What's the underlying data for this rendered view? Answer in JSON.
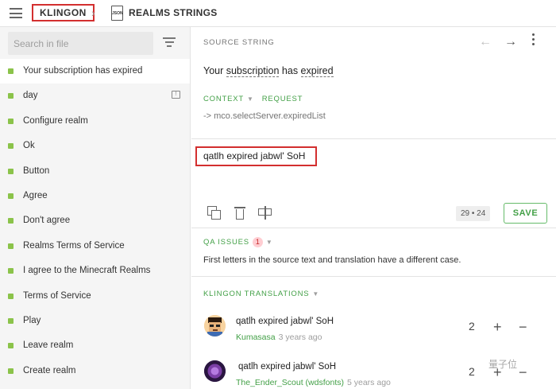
{
  "header": {
    "language": "KLINGON",
    "breadcrumb_separator": "›",
    "file_icon_label": "JSON",
    "file_name": "REALMS STRINGS"
  },
  "sidebar": {
    "search_placeholder": "Search in file",
    "items": [
      {
        "label": "Your subscription has expired",
        "active": true
      },
      {
        "label": "day",
        "has_comment": true
      },
      {
        "label": "Configure realm"
      },
      {
        "label": "Ok"
      },
      {
        "label": "Button"
      },
      {
        "label": "Agree"
      },
      {
        "label": "Don't agree"
      },
      {
        "label": "Realms Terms of Service"
      },
      {
        "label": "I agree to the Minecraft Realms"
      },
      {
        "label": "Terms of Service"
      },
      {
        "label": "Play"
      },
      {
        "label": "Leave realm"
      },
      {
        "label": "Create realm"
      }
    ],
    "status_color": "#8bc34a"
  },
  "source": {
    "header": "SOURCE STRING",
    "text_part1": "Your ",
    "term1": "subscription",
    "text_part2": " has ",
    "term2": "expired",
    "context_label": "CONTEXT",
    "request_label": "REQUEST",
    "context_value": "-> mco.selectServer.expiredList"
  },
  "editor": {
    "translation": "qatlh expired jabwl' SoH",
    "counter": "29 • 24",
    "save_label": "SAVE"
  },
  "qa": {
    "header": "QA ISSUES",
    "count": "1",
    "message": "First letters in the source text and translation have a different case."
  },
  "translations": {
    "header": "KLINGON TRANSLATIONS",
    "items": [
      {
        "text": "qatlh expired jabwl' SoH",
        "author": "Kumasasa",
        "time": "3 years ago",
        "votes": "2"
      },
      {
        "text": "qatlh expired jabwl' SoH",
        "author": "The_Ender_Scout (wdsfonts)",
        "time": "5 years ago",
        "votes": "2"
      }
    ]
  },
  "watermark": "量子位",
  "colors": {
    "accent": "#43a047",
    "highlight": "#d32f2f"
  }
}
